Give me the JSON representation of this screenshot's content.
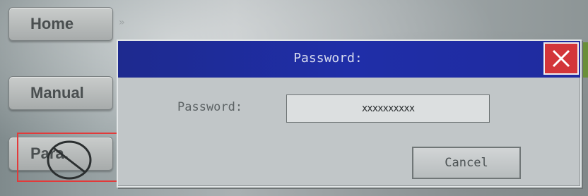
{
  "nav": {
    "home_label": "Home",
    "manual_label": "Manual",
    "para_label": "Para.",
    "arrows": "»"
  },
  "dialog": {
    "title": "Password:",
    "field_label": "Password:",
    "field_value": "xxxxxxxxxx",
    "cancel_label": "Cancel",
    "close_icon": "close-icon"
  },
  "colors": {
    "titlebar": "#1f2ea8",
    "close_button": "#d3363a",
    "highlight": "#e23a3a"
  }
}
